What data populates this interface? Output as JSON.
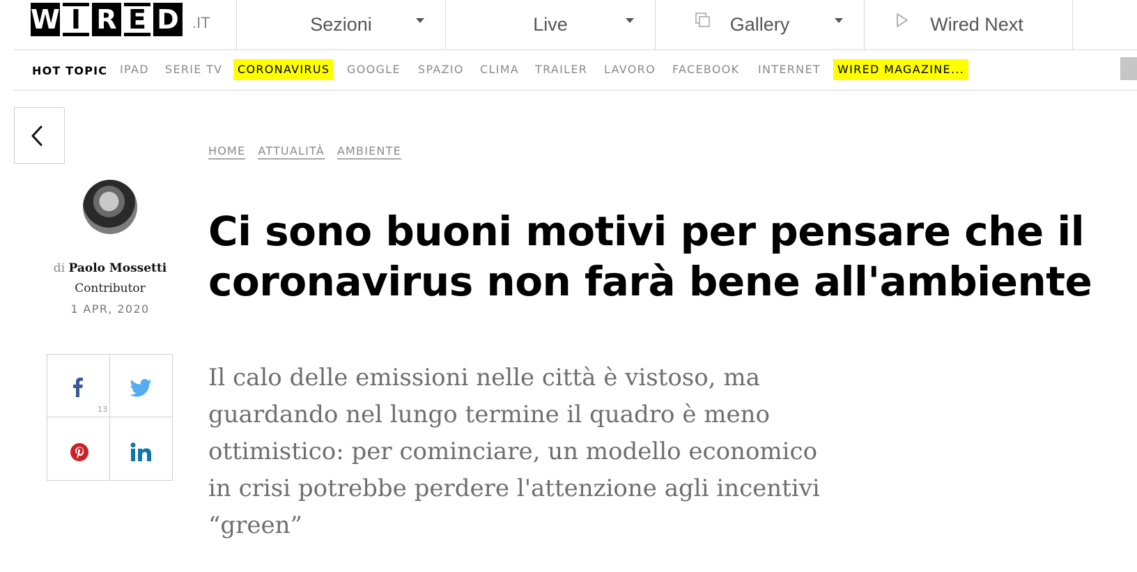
{
  "header": {
    "logo_letters": [
      "W",
      "I",
      "R",
      "E",
      "D"
    ],
    "logo_suffix": ".IT",
    "nav": [
      {
        "label": "Sezioni",
        "has_dropdown": true
      },
      {
        "label": "Live",
        "has_dropdown": true
      },
      {
        "label": "Gallery",
        "icon": "gallery-icon",
        "has_dropdown": true
      },
      {
        "label": "Wired Next",
        "icon": "play-icon",
        "has_dropdown": false
      }
    ]
  },
  "hot_topics": {
    "title": "HOT TOPIC",
    "items": [
      {
        "label": "IPAD",
        "highlighted": false
      },
      {
        "label": "SERIE TV",
        "highlighted": false
      },
      {
        "label": "CORONAVIRUS",
        "highlighted": true
      },
      {
        "label": "GOOGLE",
        "highlighted": false
      },
      {
        "label": "SPAZIO",
        "highlighted": false
      },
      {
        "label": "CLIMA",
        "highlighted": false
      },
      {
        "label": "TRAILER",
        "highlighted": false
      },
      {
        "label": "LAVORO",
        "highlighted": false
      },
      {
        "label": "FACEBOOK",
        "highlighted": false
      },
      {
        "label": "INTERNET",
        "highlighted": false
      },
      {
        "label": "WIRED MAGAZINE...",
        "highlighted": true
      }
    ],
    "highlight_color": "#ffff00"
  },
  "author": {
    "prefix": "di",
    "name": "Paolo Mossetti",
    "role": "Contributor",
    "date": "1 APR, 2020"
  },
  "share": {
    "facebook_count": "13",
    "icons": [
      "facebook-icon",
      "twitter-icon",
      "pinterest-icon",
      "linkedin-icon"
    ],
    "colors": {
      "facebook": "#3b5998",
      "twitter": "#55acee",
      "pinterest": "#cb2027",
      "linkedin": "#0e76a8"
    }
  },
  "article": {
    "breadcrumb": [
      "HOME",
      "ATTUALITÀ",
      "AMBIENTE"
    ],
    "headline_lines": [
      "Ci sono buoni motivi per pensare che il",
      "coronavirus non farà bene all'ambiente"
    ],
    "dek": "Il calo delle emissioni nelle città è vistoso, ma guardando nel lungo termine il quadro è meno ottimistico: per cominciare, un modello economico in crisi potrebbe perdere l'attenzione agli incentivi “green”"
  }
}
